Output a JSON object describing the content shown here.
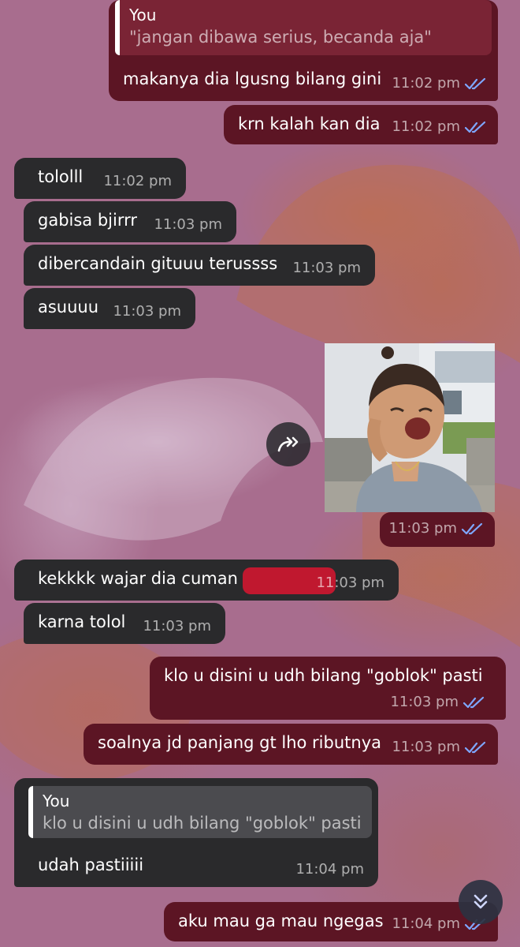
{
  "messages": [
    {
      "id": "m1",
      "dir": "out",
      "reply": {
        "name": "You",
        "text": "\"jangan dibawa serius, becanda aja\""
      },
      "text": "makanya dia lgusng bilang gini",
      "time": "11:02 pm"
    },
    {
      "id": "m2",
      "dir": "out",
      "text": "krn kalah kan dia",
      "time": "11:02 pm"
    },
    {
      "id": "m3",
      "dir": "in",
      "text": "tololll",
      "time": "11:02 pm"
    },
    {
      "id": "m4",
      "dir": "in",
      "text": "gabisa bjirrr",
      "time": "11:03 pm"
    },
    {
      "id": "m5",
      "dir": "in",
      "text": "dibercandain gituuu terussss",
      "time": "11:03 pm"
    },
    {
      "id": "m6",
      "dir": "in",
      "text": "asuuuu",
      "time": "11:03 pm"
    },
    {
      "id": "m7",
      "dir": "out",
      "type": "photo",
      "time": "11:03 pm"
    },
    {
      "id": "m8",
      "dir": "in",
      "text": "kekkkk wajar dia cuman di",
      "time": "11:03 pm",
      "redacted": true
    },
    {
      "id": "m9",
      "dir": "in",
      "text": "karna tolol",
      "time": "11:03 pm"
    },
    {
      "id": "m10",
      "dir": "out",
      "text": "klo u disini u udh bilang \"goblok\" pasti",
      "time": "11:03 pm"
    },
    {
      "id": "m11",
      "dir": "out",
      "text": "soalnya jd panjang gt lho ributnya",
      "time": "11:03 pm"
    },
    {
      "id": "m12",
      "dir": "in",
      "reply": {
        "name": "You",
        "text": "klo u disini u udh bilang \"goblok\" pasti"
      },
      "text": "udah pastiiiii",
      "time": "11:04 pm"
    },
    {
      "id": "m13",
      "dir": "out",
      "text": "aku mau ga mau ngegas",
      "time": "11:04 pm"
    }
  ],
  "colors": {
    "outgoing": "#5c1524",
    "incoming": "#2a2a2c",
    "read_check": "#7ea7ff"
  },
  "icons": {
    "forward": "forward-icon",
    "scroll_down": "double-chevron-down-icon",
    "read": "double-check-icon"
  }
}
